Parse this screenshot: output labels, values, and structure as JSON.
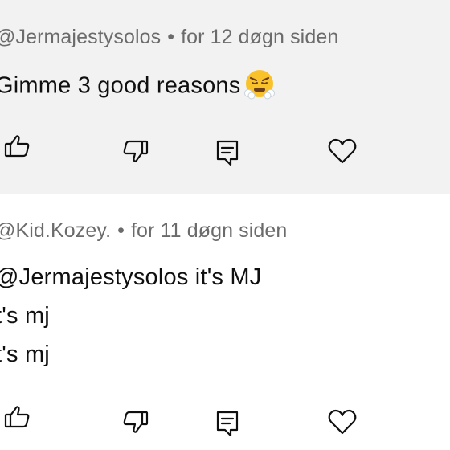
{
  "comments": [
    {
      "handle": "@Jermajestysolos",
      "separator": "•",
      "time": "for 12 døgn siden",
      "lines": [
        "Gimme 3 good reasons"
      ],
      "emoji": "face-with-steam-from-nose"
    },
    {
      "handle": "@Kid.Kozey.",
      "separator": "•",
      "time": "for 11 døgn siden",
      "lines": [
        "@Jermajestysolos it's MJ",
        "t's mj",
        "t's mj"
      ]
    }
  ],
  "icons": {
    "like": "thumbs-up-icon",
    "dislike": "thumbs-down-icon",
    "reply": "reply-comment-icon",
    "heart": "heart-icon"
  },
  "colors": {
    "highlight_bg": "#f2f2f2",
    "meta_text": "#6b6b6b",
    "body_text": "#0f0f0f"
  }
}
